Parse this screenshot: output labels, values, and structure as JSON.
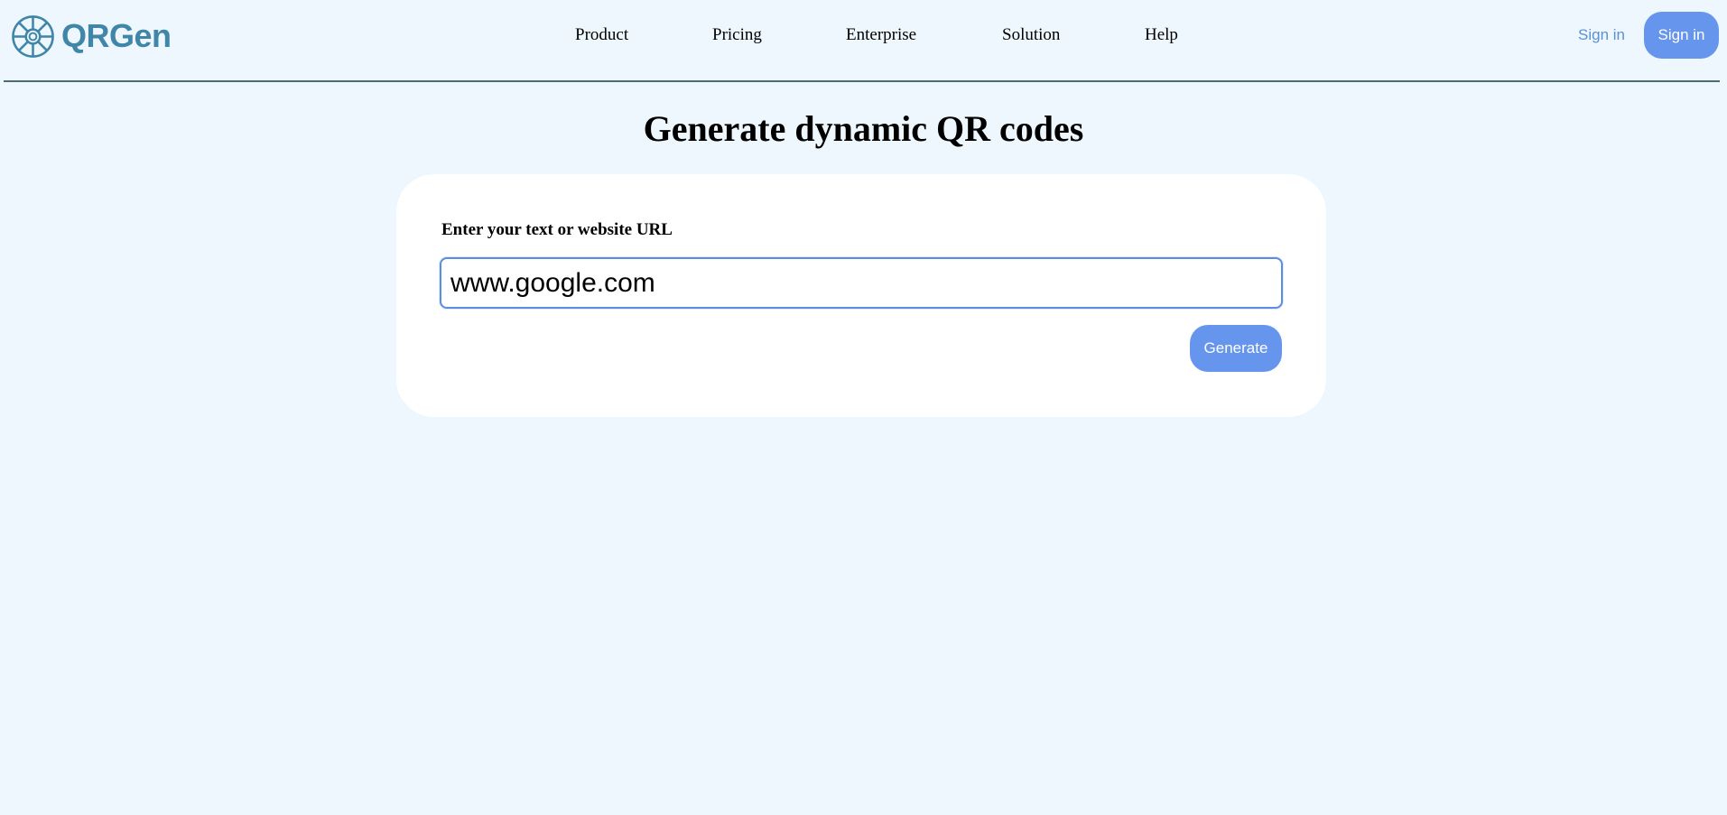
{
  "header": {
    "brand": "QRGen",
    "logo_icon": "ship-wheel-icon",
    "brand_color": "#3f86a8",
    "nav": [
      {
        "label": "Product"
      },
      {
        "label": "Pricing"
      },
      {
        "label": "Enterprise"
      },
      {
        "label": "Solution"
      },
      {
        "label": "Help"
      }
    ],
    "signin_link_label": "Sign in",
    "signin_button_label": "Sign in"
  },
  "main": {
    "title": "Generate dynamic QR codes",
    "form": {
      "label": "Enter your text or website URL",
      "input_value": "www.google.com",
      "generate_label": "Generate"
    }
  },
  "colors": {
    "background": "#eef7fe",
    "accent": "#6695ed",
    "link": "#5b8fd6",
    "divider": "#4e6b6e"
  }
}
